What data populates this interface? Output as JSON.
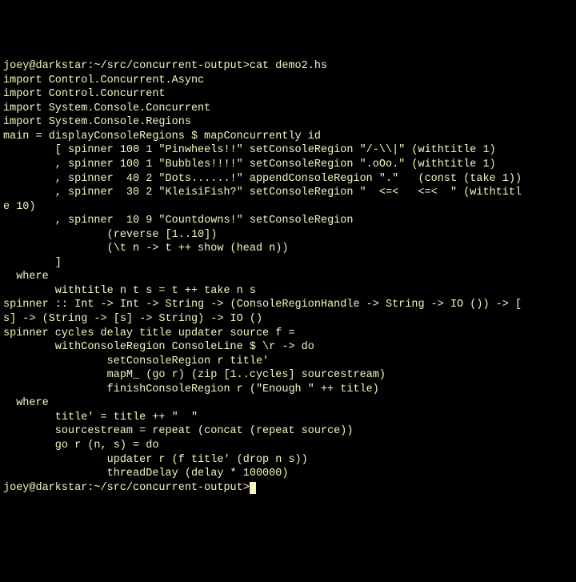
{
  "terminal": {
    "lines": [
      "joey@darkstar:~/src/concurrent-output>cat demo2.hs",
      "import Control.Concurrent.Async",
      "import Control.Concurrent",
      "import System.Console.Concurrent",
      "import System.Console.Regions",
      "",
      "main = displayConsoleRegions $ mapConcurrently id",
      "        [ spinner 100 1 \"Pinwheels!!\" setConsoleRegion \"/-\\\\|\" (withtitle 1)",
      "        , spinner 100 1 \"Bubbles!!!!\" setConsoleRegion \".oOo.\" (withtitle 1)",
      "        , spinner  40 2 \"Dots......!\" appendConsoleRegion \".\"   (const (take 1))",
      "        , spinner  30 2 \"KleisiFish?\" setConsoleRegion \"  <=<   <=<  \" (withtitl",
      "e 10)",
      "        , spinner  10 9 \"Countdowns!\" setConsoleRegion",
      "                (reverse [1..10])",
      "                (\\t n -> t ++ show (head n))",
      "        ]",
      "  where",
      "        withtitle n t s = t ++ take n s",
      "",
      "spinner :: Int -> Int -> String -> (ConsoleRegionHandle -> String -> IO ()) -> [",
      "s] -> (String -> [s] -> String) -> IO ()",
      "spinner cycles delay title updater source f =",
      "        withConsoleRegion ConsoleLine $ \\r -> do",
      "                setConsoleRegion r title'",
      "                mapM_ (go r) (zip [1..cycles] sourcestream)",
      "                finishConsoleRegion r (\"Enough \" ++ title)",
      "  where",
      "        title' = title ++ \"  \"",
      "        sourcestream = repeat (concat (repeat source))",
      "        go r (n, s) = do",
      "                updater r (f title' (drop n s))",
      "                threadDelay (delay * 100000)"
    ],
    "final_prompt": "joey@darkstar:~/src/concurrent-output>"
  }
}
